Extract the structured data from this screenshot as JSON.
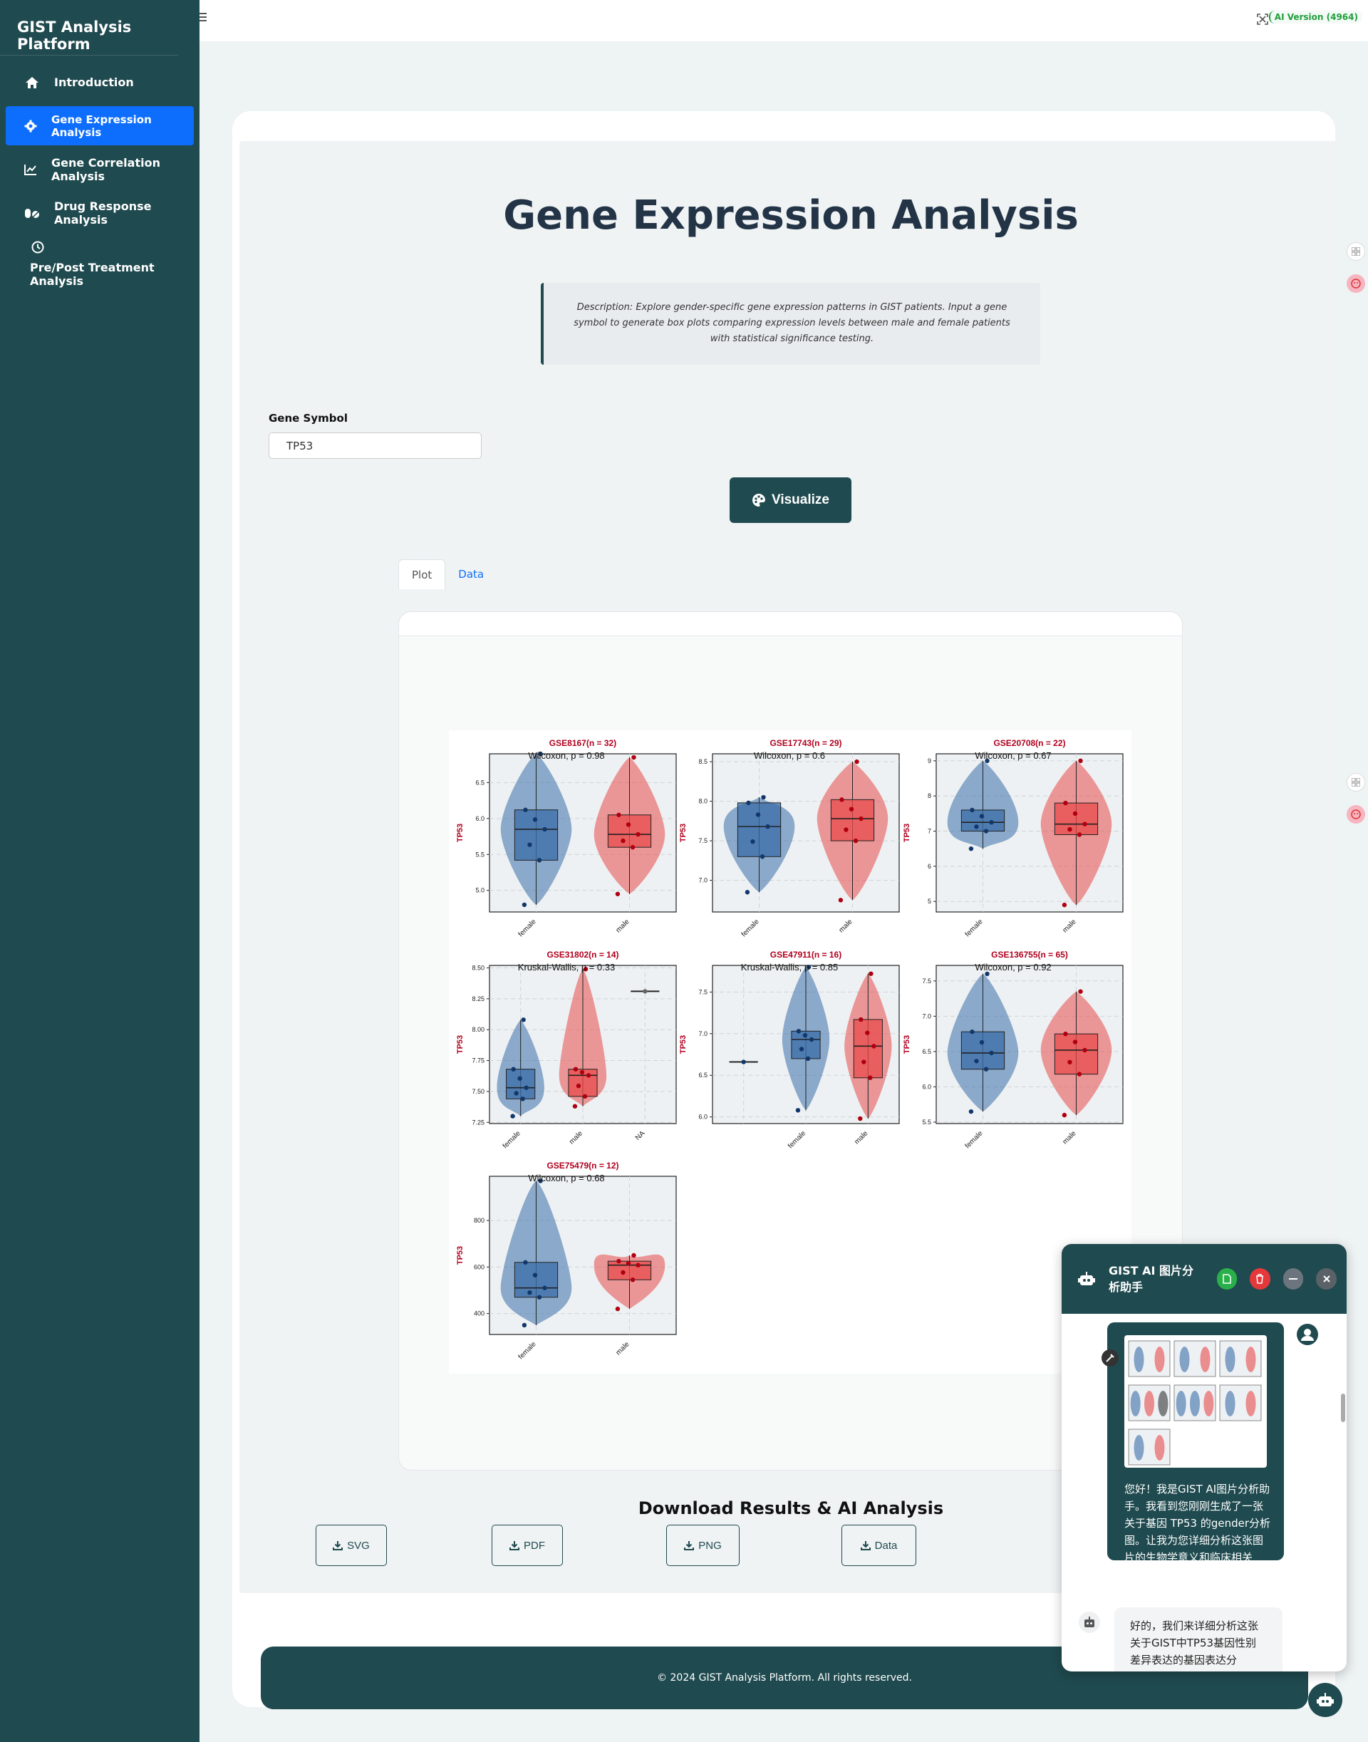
{
  "app": {
    "brand": "GIST Analysis Platform",
    "ai_version": "AI Version (4964)"
  },
  "sidebar": {
    "items": [
      {
        "label": "Introduction",
        "icon": "home-icon",
        "active": false
      },
      {
        "label": "Gene Expression Analysis",
        "icon": "gear-icon",
        "active": true
      },
      {
        "label": "Gene Correlation Analysis",
        "icon": "line-chart-icon",
        "active": false
      },
      {
        "label": "Drug Response Analysis",
        "icon": "pills-icon",
        "active": false
      },
      {
        "label": "Pre/Post Treatment Analysis",
        "icon": "clock-icon",
        "active": false
      }
    ]
  },
  "main": {
    "title": "Gene Expression Analysis",
    "description": "Description: Explore gender-specific gene expression patterns in GIST patients. Input a gene symbol to generate box plots comparing expression levels between male and female patients with statistical significance testing.",
    "gene_label": "Gene Symbol",
    "gene_value": "TP53",
    "visualize_label": "Visualize",
    "tabs": [
      {
        "label": "Plot",
        "active": true
      },
      {
        "label": "Data",
        "active": false
      }
    ],
    "download_title": "Download Results & AI Analysis",
    "download_buttons": [
      "SVG",
      "PDF",
      "PNG",
      "Data"
    ]
  },
  "footer": {
    "text": "© 2024 GIST Analysis Platform. All rights reserved."
  },
  "chat": {
    "title": "GIST AI 图片分析助手",
    "user_message": "您好！我是GIST AI图片分析助手。我看到您刚刚生成了一张关于基因 TP53 的gender分析图。让我为您详细分析这张图片的生物学意义和临床相关性。",
    "bot_message": "好的，我们来详细分析这张关于GIST中TP53基因性别差异表达的基因表达分"
  },
  "colors": {
    "female": "#3a6ea8",
    "male": "#e84b4b",
    "na": "#4cae4c",
    "title_red": "#b0001e",
    "primary": "#1f4a4f",
    "accent": "#0d6efd"
  },
  "chart_data": [
    {
      "type": "box",
      "title": "GSE8167(n = 32)",
      "test": "Wilcoxon, p = 0.98",
      "ylabel": "TP53",
      "categories": [
        "female",
        "male"
      ],
      "yticks": [
        "5.0",
        "5.5",
        "6.0",
        "6.5"
      ],
      "ylim": [
        4.7,
        6.9
      ],
      "boxes": [
        {
          "q1": 5.42,
          "median": 5.85,
          "q3": 6.12,
          "min": 4.8,
          "max": 6.9
        },
        {
          "q1": 5.6,
          "median": 5.78,
          "q3": 6.05,
          "min": 4.95,
          "max": 6.85
        }
      ]
    },
    {
      "type": "box",
      "title": "GSE17743(n = 29)",
      "test": "Wilcoxon, p = 0.6",
      "ylabel": "TP53",
      "categories": [
        "female",
        "male"
      ],
      "yticks": [
        "7.0",
        "7.5",
        "8.0",
        "8.5"
      ],
      "ylim": [
        6.6,
        8.6
      ],
      "boxes": [
        {
          "q1": 7.3,
          "median": 7.68,
          "q3": 7.98,
          "min": 6.85,
          "max": 8.05
        },
        {
          "q1": 7.5,
          "median": 7.78,
          "q3": 8.02,
          "min": 6.75,
          "max": 8.5
        }
      ]
    },
    {
      "type": "box",
      "title": "GSE20708(n = 22)",
      "test": "Wilcoxon, p = 0.67",
      "ylabel": "TP53",
      "categories": [
        "female",
        "male"
      ],
      "yticks": [
        "5",
        "6",
        "7",
        "8",
        "9"
      ],
      "ylim": [
        4.7,
        9.2
      ],
      "boxes": [
        {
          "q1": 7.0,
          "median": 7.25,
          "q3": 7.6,
          "min": 6.5,
          "max": 9.0
        },
        {
          "q1": 6.9,
          "median": 7.2,
          "q3": 7.8,
          "min": 4.9,
          "max": 9.0
        }
      ]
    },
    {
      "type": "box",
      "title": "GSE31802(n = 14)",
      "test": "Kruskal-Wallis, p = 0.33",
      "ylabel": "TP53",
      "categories": [
        "female",
        "male",
        "NA"
      ],
      "yticks": [
        "7.25",
        "7.50",
        "7.75",
        "8.00",
        "8.25",
        "8.50"
      ],
      "ylim": [
        7.24,
        8.52
      ],
      "boxes": [
        {
          "q1": 7.44,
          "median": 7.53,
          "q3": 7.68,
          "min": 7.3,
          "max": 8.08
        },
        {
          "q1": 7.46,
          "median": 7.63,
          "q3": 7.68,
          "min": 7.38,
          "max": 8.49
        },
        {
          "q1": 8.31,
          "median": 8.31,
          "q3": 8.31,
          "min": 8.31,
          "max": 8.31
        }
      ]
    },
    {
      "type": "box",
      "title": "GSE47911(n = 16)",
      "test": "Kruskal-Wallis, p = 0.85",
      "ylabel": "TP53",
      "categories": [
        "",
        "female",
        "male"
      ],
      "yticks": [
        "6.0",
        "6.5",
        "7.0",
        "7.5"
      ],
      "ylim": [
        5.92,
        7.82
      ],
      "boxes": [
        {
          "q1": 6.66,
          "median": 6.66,
          "q3": 6.66,
          "min": 6.66,
          "max": 6.66
        },
        {
          "q1": 6.7,
          "median": 6.93,
          "q3": 7.03,
          "min": 6.08,
          "max": 7.8
        },
        {
          "q1": 6.47,
          "median": 6.85,
          "q3": 7.17,
          "min": 5.98,
          "max": 7.72
        }
      ]
    },
    {
      "type": "box",
      "title": "GSE136755(n = 65)",
      "test": "Wilcoxon, p = 0.92",
      "ylabel": "TP53",
      "categories": [
        "female",
        "male"
      ],
      "yticks": [
        "5.5",
        "6.0",
        "6.5",
        "7.0",
        "7.5"
      ],
      "ylim": [
        5.48,
        7.72
      ],
      "boxes": [
        {
          "q1": 6.25,
          "median": 6.48,
          "q3": 6.78,
          "min": 5.65,
          "max": 7.6
        },
        {
          "q1": 6.18,
          "median": 6.52,
          "q3": 6.75,
          "min": 5.6,
          "max": 7.35
        }
      ]
    },
    {
      "type": "box",
      "title": "GSE75479(n = 12)",
      "test": "Wilcoxon, p = 0.68",
      "ylabel": "TP53",
      "categories": [
        "female",
        "male"
      ],
      "yticks": [
        "400",
        "600",
        "800"
      ],
      "ylim": [
        310,
        990
      ],
      "boxes": [
        {
          "q1": 470,
          "median": 510,
          "q3": 620,
          "min": 350,
          "max": 970
        },
        {
          "q1": 545,
          "median": 608,
          "q3": 625,
          "min": 420,
          "max": 650
        }
      ]
    }
  ]
}
